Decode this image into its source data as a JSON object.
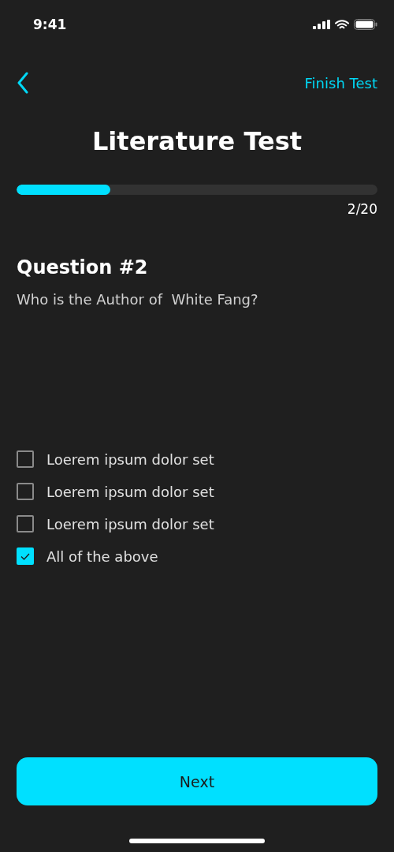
{
  "status_bar": {
    "time": "9:41"
  },
  "nav": {
    "action": "Finish Test"
  },
  "title": "Literature Test",
  "progress": {
    "level": 0.26,
    "counter": "2/20"
  },
  "question": {
    "heading": "Question #2",
    "text": "Who is the Author of  White Fang?"
  },
  "options": [
    {
      "label": "Loerem ipsum dolor set",
      "checked": false
    },
    {
      "label": "Loerem ipsum dolor set",
      "checked": false
    },
    {
      "label": "Loerem ipsum dolor set",
      "checked": false
    },
    {
      "label": "All of the above",
      "checked": true
    }
  ],
  "next_button": "Next"
}
